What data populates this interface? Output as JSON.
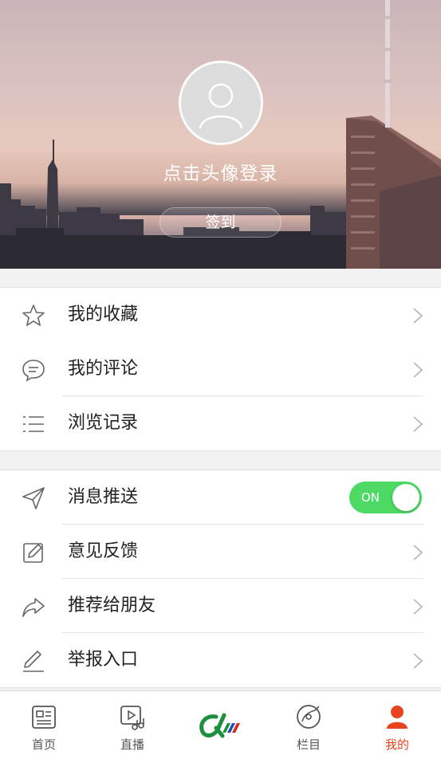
{
  "header": {
    "login_prompt": "点击头像登录",
    "signin_label": "签到"
  },
  "menu_group_1": [
    {
      "label": "我的收藏",
      "icon": "star-icon"
    },
    {
      "label": "我的评论",
      "icon": "comment-icon"
    },
    {
      "label": "浏览记录",
      "icon": "list-icon"
    }
  ],
  "menu_group_2": [
    {
      "label": "消息推送",
      "icon": "send-icon",
      "toggle": "ON"
    },
    {
      "label": "意见反馈",
      "icon": "edit-box-icon"
    },
    {
      "label": "推荐给朋友",
      "icon": "share-icon"
    },
    {
      "label": "举报入口",
      "icon": "pencil-icon"
    }
  ],
  "tabbar": [
    {
      "label": "首页",
      "icon": "news-icon"
    },
    {
      "label": "直播",
      "icon": "live-video-icon"
    },
    {
      "label": "",
      "icon": "app-logo-icon"
    },
    {
      "label": "栏目",
      "icon": "disc-icon"
    },
    {
      "label": "我的",
      "icon": "user-icon",
      "active": true
    }
  ],
  "colors": {
    "accent": "#e8431c",
    "toggle_on": "#4cd964",
    "logo_green": "#1a8f3c"
  }
}
